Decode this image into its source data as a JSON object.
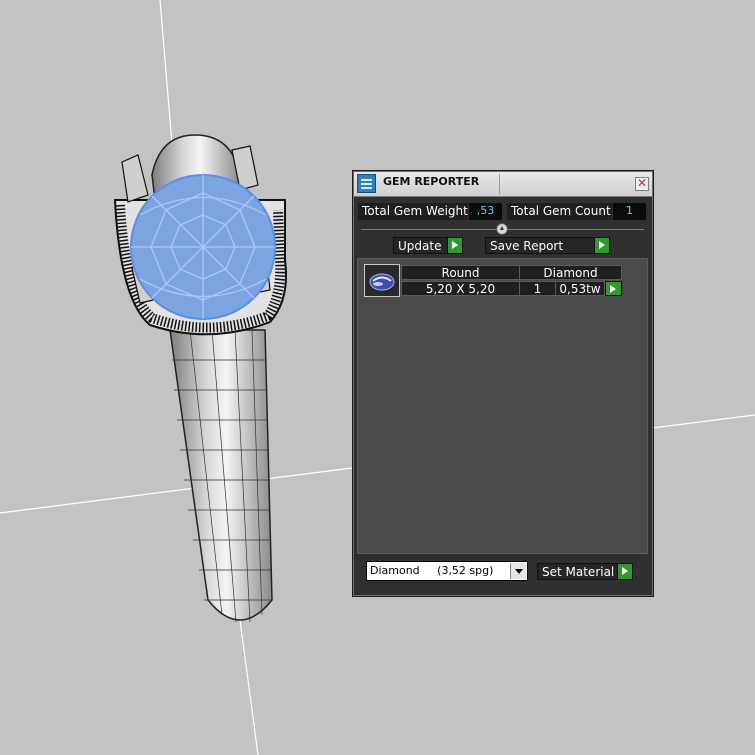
{
  "window": {
    "title": "GEM REPORTER",
    "close_icon": "close-icon",
    "app_icon": "gem-reporter-icon"
  },
  "totals": {
    "weight_label": "Total Gem Weight",
    "weight_value": ",53",
    "count_label": "Total Gem Count",
    "count_value": "1"
  },
  "actions": {
    "update_label": "Update",
    "save_report_label": "Save Report"
  },
  "gems": [
    {
      "thumbnail": "round-gem-icon",
      "shape": "Round",
      "material": "Diamond",
      "size": "5,20 X 5,20",
      "count": "1",
      "weight": "0,53tw"
    }
  ],
  "material": {
    "selected": "Diamond     (3,52 spg)",
    "set_label": "Set Material"
  },
  "colors": {
    "panel_bg": "#303030",
    "list_bg": "#4a4a4a",
    "value_text": "#5fd0ff",
    "play_button": "#2f9a2f",
    "gem_highlight": "#5b8fe0",
    "viewport_bg": "#c3c3c3"
  }
}
